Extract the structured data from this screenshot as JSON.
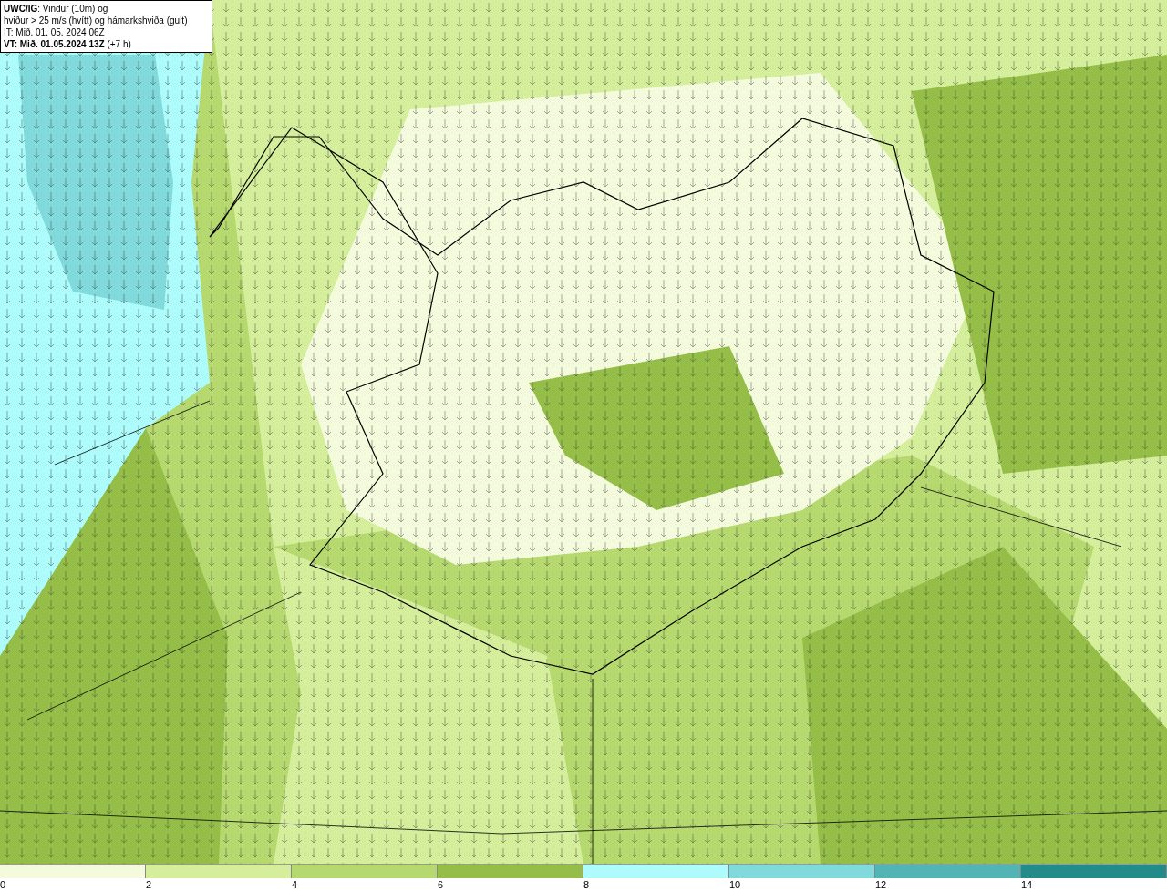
{
  "title_box": {
    "lines": [
      "**UWC/IG**: Vindur (10m) og",
      "hviður > 25 m/s (hvítt) og hámarkshviða (gult)",
      "IT: Mið. 01. 05. 2024 06Z",
      "**VT: Mið. 01.05.2024 13Z** (+7 h)"
    ]
  },
  "legend": [
    {
      "label": "0",
      "color": "#f4fbdc"
    },
    {
      "label": "2",
      "color": "#d4ee9c"
    },
    {
      "label": "4",
      "color": "#b6d96f"
    },
    {
      "label": "6",
      "color": "#95be48"
    },
    {
      "label": "8",
      "color": "#adfcfb"
    },
    {
      "label": "10",
      "color": "#80d9da"
    },
    {
      "label": "12",
      "color": "#53b4b6"
    },
    {
      "label": "14",
      "color": "#238b8a"
    }
  ]
}
